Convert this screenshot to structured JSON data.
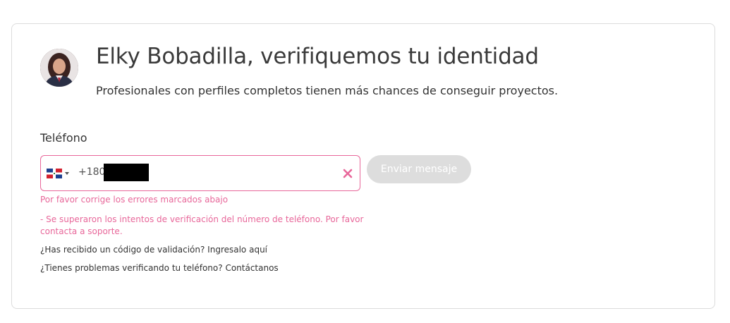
{
  "header": {
    "title": "Elky Bobadilla, verifiquemos tu identidad",
    "subtitle": "Profesionales con perfiles completos tienen más chances de conseguir proyectos."
  },
  "phone_field": {
    "label": "Teléfono",
    "country_flag": "dominican-republic-flag",
    "value": "+1809"
  },
  "send_button": {
    "label": "Enviar mensaje"
  },
  "errors": {
    "main": "Por favor corrige los errores marcados abajo",
    "detail": "- Se superaron los intentos de verificación del número de teléfono. Por favor contacta a soporte."
  },
  "help_links": {
    "received_code": "¿Has recibido un código de validación? Ingresalo aquí",
    "problems": "¿Tienes problemas verificando tu teléfono? Contáctanos"
  },
  "colors": {
    "error_accent": "#e8679a",
    "disabled_button": "#dddddd",
    "card_border": "#dcdcdc"
  }
}
